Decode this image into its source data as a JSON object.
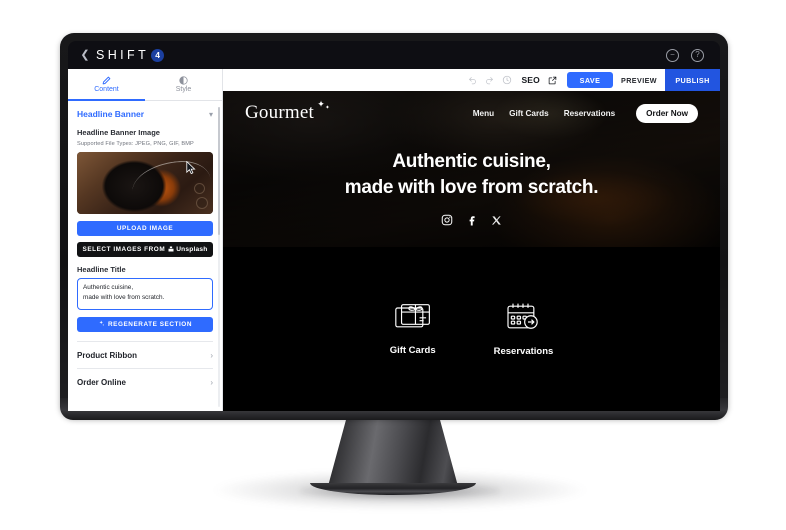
{
  "window": {
    "back_icon": "chevron-left-icon",
    "brand_text": "SHIFT",
    "brand_badge": "4",
    "minimize_icon": "minimize-circle-icon",
    "help_icon": "help-circle-icon"
  },
  "sidebar": {
    "tabs": [
      {
        "label": "Content",
        "icon": "pencil-icon",
        "active": true
      },
      {
        "label": "Style",
        "icon": "contrast-icon",
        "active": false
      }
    ],
    "section": {
      "title": "Headline Banner",
      "collapse_icon": "chevron-down-icon",
      "image_label": "Headline Banner Image",
      "image_hint": "Supported File Types: JPEG, PNG, GIF, BMP",
      "thumbnail_alt": "grilled-steak-skillet-photo",
      "upload_button": "UPLOAD IMAGE",
      "unsplash_prefix": "SELECT IMAGES FROM",
      "unsplash_name": "Unsplash",
      "unsplash_icon": "unsplash-icon",
      "title_label": "Headline Title",
      "title_value_line1": "Authentic cuisine,",
      "title_value_line2": "made with love from scratch.",
      "regenerate_button": "REGENERATE SECTION",
      "regenerate_icon": "sparkle-icon"
    },
    "accordions": [
      {
        "label": "Product Ribbon",
        "icon": "chevron-right-icon"
      },
      {
        "label": "Order Online",
        "icon": "chevron-right-icon"
      }
    ]
  },
  "toolbar": {
    "undo_icon": "undo-icon",
    "redo_icon": "redo-icon",
    "history_icon": "history-clock-icon",
    "seo_label": "SEO",
    "external_icon": "external-link-icon",
    "save_label": "SAVE",
    "preview_label": "PREVIEW",
    "publish_label": "PUBLISH",
    "colors": {
      "primary": "#2f6bff",
      "publish": "#2255e0"
    }
  },
  "preview": {
    "logo": "Gourmet",
    "nav_links": [
      "Menu",
      "Gift Cards",
      "Reservations"
    ],
    "order_button": "Order Now",
    "headline_line1": "Authentic cuisine,",
    "headline_line2": "made with love from scratch.",
    "socials": [
      {
        "name": "instagram-icon"
      },
      {
        "name": "facebook-icon"
      },
      {
        "name": "x-twitter-icon"
      }
    ],
    "cards": [
      {
        "label": "Gift Cards",
        "icon": "gift-card-icon"
      },
      {
        "label": "Reservations",
        "icon": "calendar-arrow-icon"
      }
    ]
  }
}
